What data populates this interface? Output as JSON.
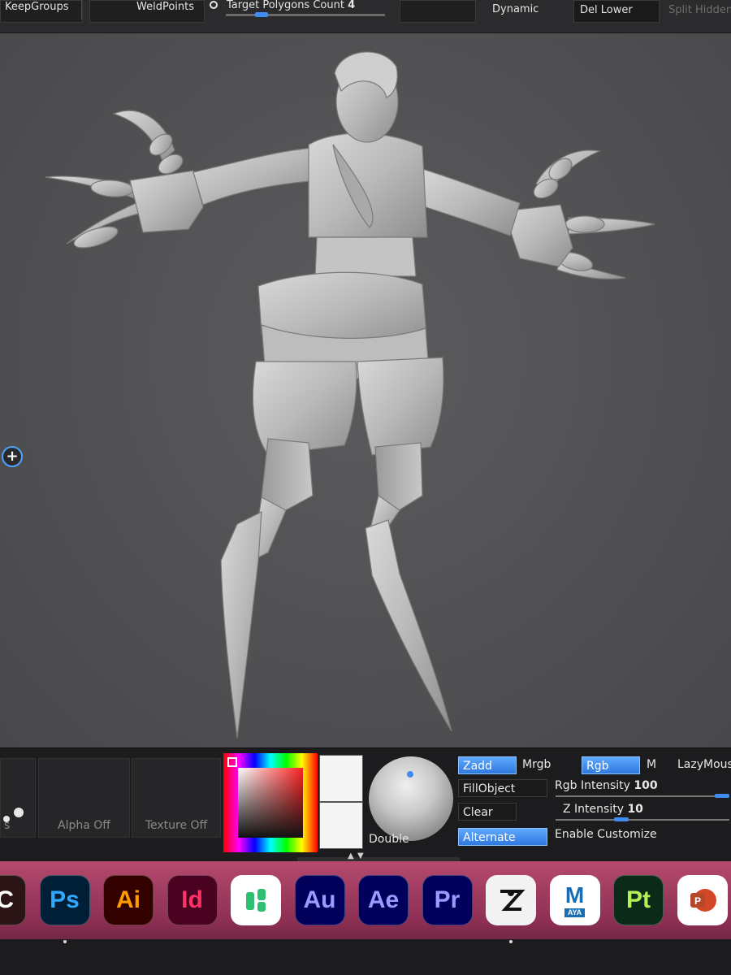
{
  "toolbar": {
    "keep_groups": "KeepGroups",
    "weld_points": "WeldPoints",
    "target_polygons_label": "Target Polygons Count",
    "target_polygons_value": "4",
    "target_polygons_fraction": 0.2,
    "dynamic": "Dynamic",
    "del_lower": "Del Lower",
    "split_hidden": "Split Hidden"
  },
  "viewport": {
    "gizmo_icon": "plus-circle-icon",
    "accent": "#4da3ff"
  },
  "bottom_panel": {
    "alpha_label": "Alpha Off",
    "texture_label": "Texture Off",
    "stroke_label": "s",
    "material_label": "Double",
    "buttons": {
      "zadd": "Zadd",
      "mrgb": "Mrgb",
      "rgb": "Rgb",
      "m": "M",
      "lazymouse": "LazyMous",
      "fill_object": "FillObject",
      "clear": "Clear",
      "alternate": "Alternate",
      "enable_customize": "Enable Customize"
    },
    "rgb_intensity": {
      "label": "Rgb",
      "label2": "Intensity",
      "value": "100",
      "fraction": 1.0
    },
    "z_intensity": {
      "label": "Z Intensity",
      "value": "10",
      "fraction": 0.1
    },
    "active_color": "#3f8df0"
  },
  "dock": {
    "apps": [
      {
        "name": "creative-cloud",
        "label": "C",
        "bg": "#2b1416",
        "fg": "#ffffff",
        "running": false
      },
      {
        "name": "photoshop",
        "label": "Ps",
        "bg": "#001e36",
        "fg": "#31a8ff",
        "running": true
      },
      {
        "name": "illustrator",
        "label": "Ai",
        "bg": "#330000",
        "fg": "#ff9a00",
        "running": false
      },
      {
        "name": "indesign",
        "label": "Id",
        "bg": "#49021f",
        "fg": "#ff3366",
        "running": false
      },
      {
        "name": "guru-app",
        "label": "",
        "bg": "#ffffff",
        "fg": "#2fbf71",
        "running": false
      },
      {
        "name": "audition",
        "label": "Au",
        "bg": "#00005b",
        "fg": "#9999ff",
        "running": false
      },
      {
        "name": "after-effects",
        "label": "Ae",
        "bg": "#00005b",
        "fg": "#9999ff",
        "running": false
      },
      {
        "name": "premiere",
        "label": "Pr",
        "bg": "#00005b",
        "fg": "#9999ff",
        "running": false
      },
      {
        "name": "zbrush",
        "label": "",
        "bg": "#f2f2f2",
        "fg": "#111111",
        "running": true
      },
      {
        "name": "maya",
        "label": "M",
        "sublabel": "AYA",
        "bg": "#ffffff",
        "fg": "#1a6db3",
        "running": false
      },
      {
        "name": "painter",
        "label": "Pt",
        "bg": "#0b2b18",
        "fg": "#b6f15a",
        "running": false
      },
      {
        "name": "powerpoint",
        "label": "P",
        "bg": "#ffffff",
        "fg": "#d24726",
        "running": false
      }
    ]
  }
}
